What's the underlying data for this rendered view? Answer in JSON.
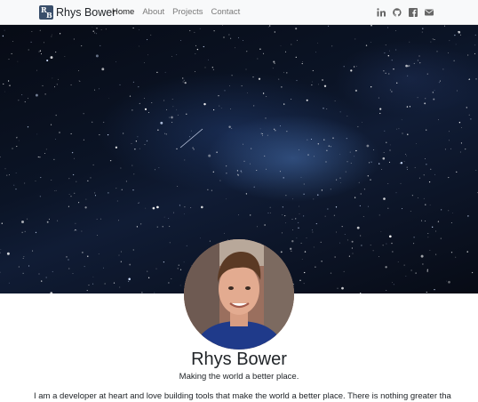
{
  "brand": {
    "name": "Rhys Bower",
    "logo_letters": [
      "R",
      "B"
    ]
  },
  "nav": {
    "links": [
      {
        "label": "Home",
        "active": true
      },
      {
        "label": "About",
        "active": false
      },
      {
        "label": "Projects",
        "active": false
      },
      {
        "label": "Contact",
        "active": false
      }
    ]
  },
  "socials": [
    {
      "icon": "linkedin-icon"
    },
    {
      "icon": "github-icon"
    },
    {
      "icon": "facebook-icon"
    },
    {
      "icon": "email-icon"
    }
  ],
  "hero": {
    "image": "starry-night-milky-way"
  },
  "profile": {
    "name": "Rhys Bower",
    "tagline": "Making the world a better place.",
    "bio": "I am a developer at heart and love building tools that make the world a better place. There is nothing greater than breaking"
  },
  "colors": {
    "navbar_bg": "#f8f9fa",
    "logo_bg": "#3a4f6b",
    "text": "#212529",
    "muted_link": "#7a7a7a"
  }
}
